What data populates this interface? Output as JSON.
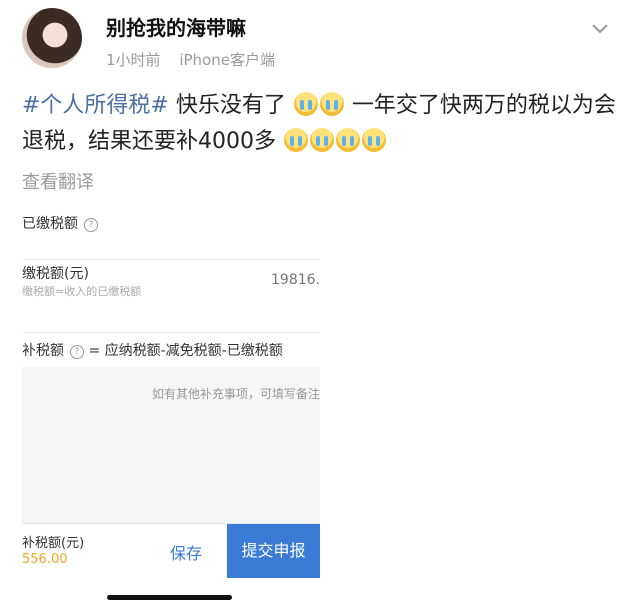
{
  "post": {
    "username": "别抢我的海带嘛",
    "time": "1小时前",
    "source": "iPhone客户端",
    "hashtag": "#个人所得税#",
    "text_1": "快乐没有了",
    "text_2": "一年交了快两万的税以为会退税，结果还要补4000多",
    "translate_label": "查看翻译",
    "emoji_crying": "crying-face-emoji"
  },
  "embedded_screenshot": {
    "paid_tax_title": "已缴税额",
    "paid_tax_label": "缴税额(元)",
    "paid_tax_note": "缴税额=收入的已缴税额",
    "paid_tax_value": "19816.",
    "supplement_title": "补税额",
    "supplement_formula": "= 应纳税额-减免税额-已缴税额",
    "notes_placeholder": "如有其他补充事项，可填写备注",
    "due_label": "补税额(元)",
    "due_value": "556.00",
    "save_label": "保存",
    "submit_label": "提交申报"
  },
  "colors": {
    "hashtag": "#4a6fa5",
    "primary": "#3a7bd5",
    "due_amount": "#f5a623"
  },
  "icons": {
    "more": "chevron-down-icon",
    "help": "question-circle-icon"
  }
}
